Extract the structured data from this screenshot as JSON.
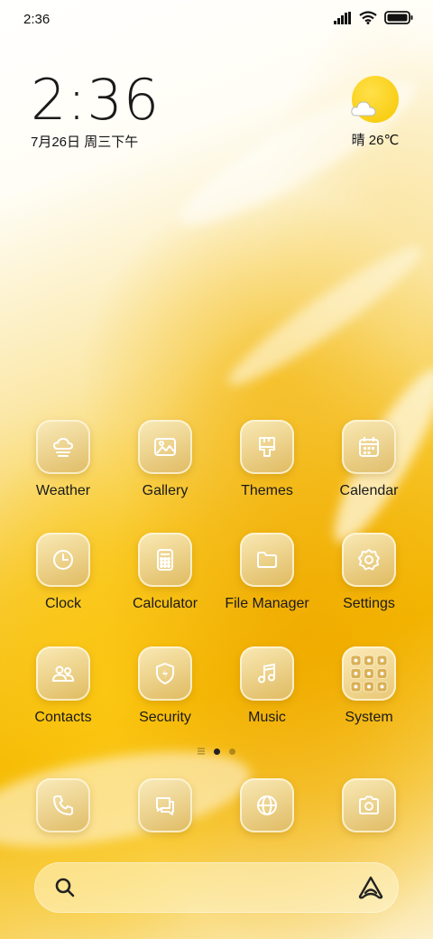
{
  "status_bar": {
    "time": "2:36"
  },
  "clock_widget": {
    "time": "2:36",
    "date": "7月26日 周三下午"
  },
  "weather_widget": {
    "temperature": "晴 26℃",
    "icon": "sun-cloud-icon"
  },
  "apps": [
    {
      "label": "Weather",
      "icon": "weather-icon"
    },
    {
      "label": "Gallery",
      "icon": "gallery-icon"
    },
    {
      "label": "Themes",
      "icon": "themes-icon"
    },
    {
      "label": "Calendar",
      "icon": "calendar-icon"
    },
    {
      "label": "Clock",
      "icon": "clock-icon"
    },
    {
      "label": "Calculator",
      "icon": "calculator-icon"
    },
    {
      "label": "File Manager",
      "icon": "folder-icon"
    },
    {
      "label": "Settings",
      "icon": "gear-icon"
    },
    {
      "label": "Contacts",
      "icon": "contacts-icon"
    },
    {
      "label": "Security",
      "icon": "shield-icon"
    },
    {
      "label": "Music",
      "icon": "music-icon"
    },
    {
      "label": "System",
      "icon": "folder-grid-icon"
    }
  ],
  "dock": [
    {
      "icon": "phone-icon"
    },
    {
      "icon": "messages-icon"
    },
    {
      "icon": "browser-icon"
    },
    {
      "icon": "camera-icon"
    }
  ],
  "pager": {
    "pages": 2,
    "current": 1
  },
  "search": {
    "icon": "search-icon",
    "assistant_icon": "assistant-icon"
  }
}
